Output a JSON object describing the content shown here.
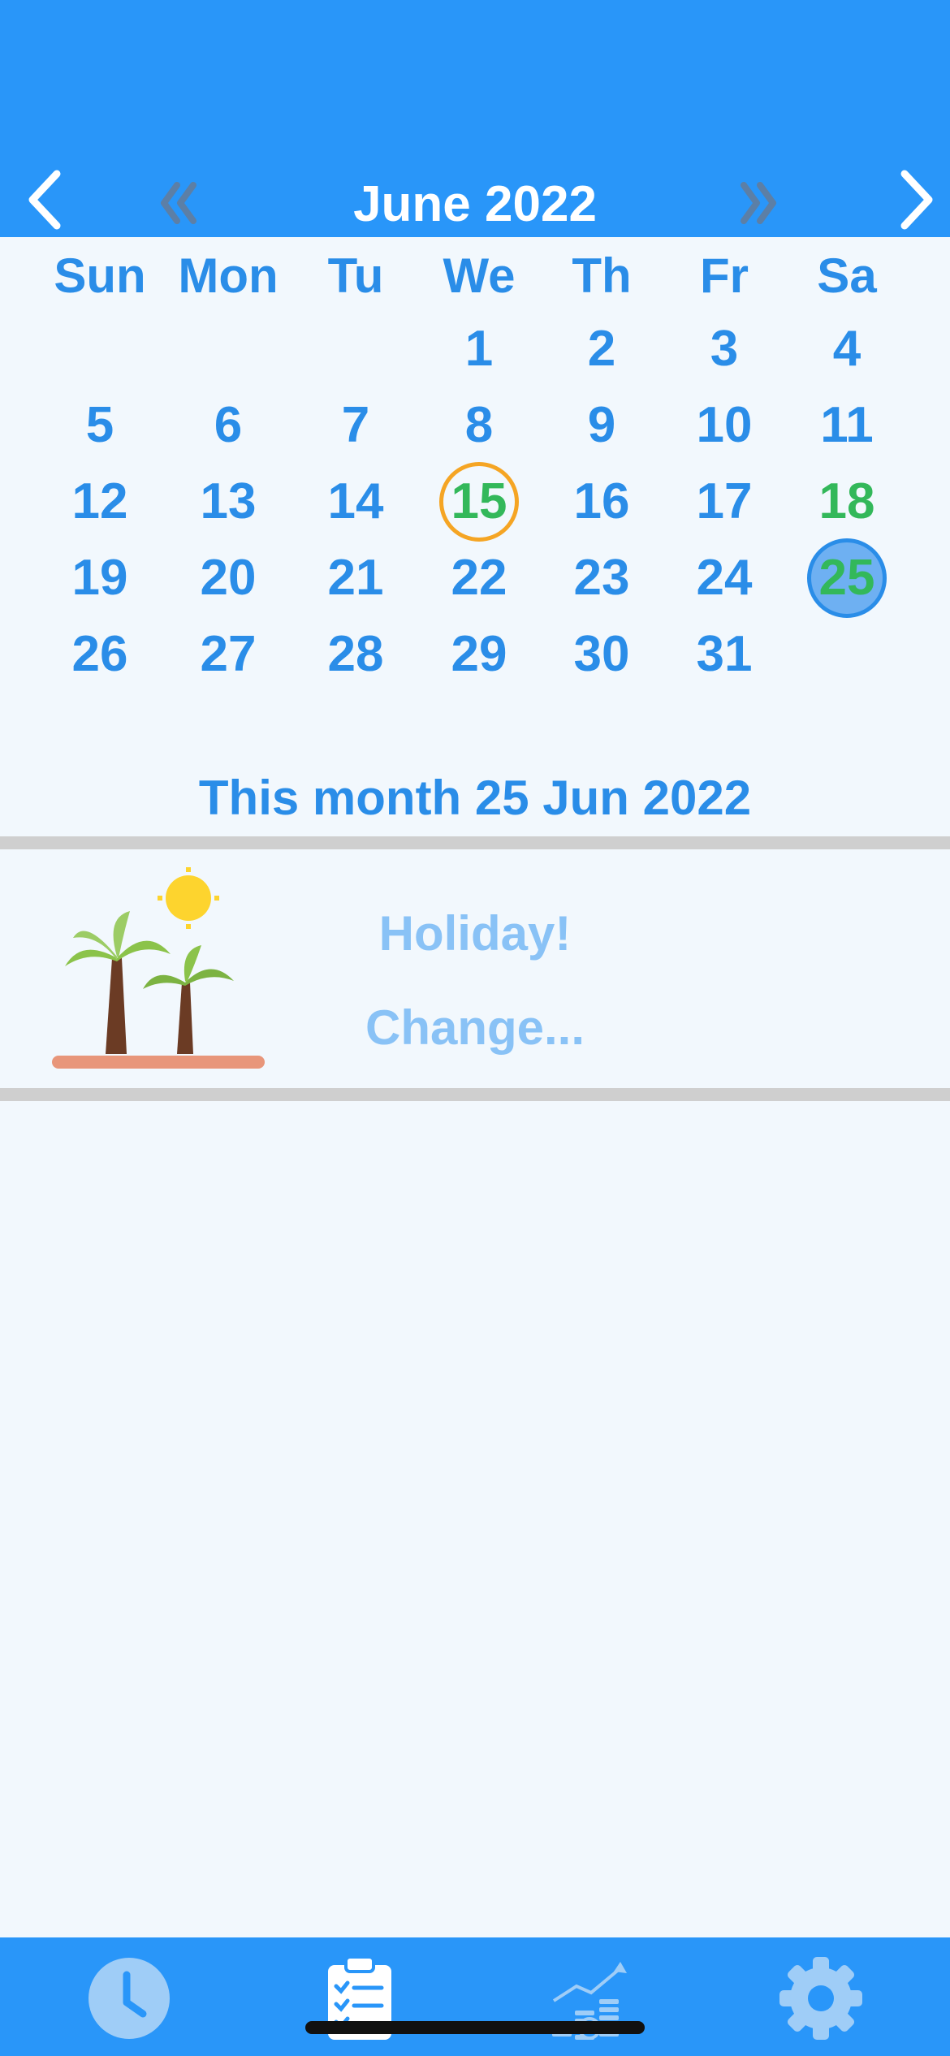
{
  "header": {
    "month_title": "June 2022",
    "icons": {
      "prev_month": "chevron-left-icon",
      "next_month": "chevron-right-icon",
      "prev_year": "double-chevron-left-icon",
      "next_year": "double-chevron-right-icon"
    }
  },
  "calendar": {
    "weekdays": [
      "Sun",
      "Mon",
      "Tu",
      "We",
      "Th",
      "Fr",
      "Sa"
    ],
    "days": [
      "1",
      "2",
      "3",
      "4",
      "5",
      "6",
      "7",
      "8",
      "9",
      "10",
      "11",
      "12",
      "13",
      "14",
      "15",
      "16",
      "17",
      "18",
      "19",
      "20",
      "21",
      "22",
      "23",
      "24",
      "25",
      "26",
      "27",
      "28",
      "29",
      "30",
      "31"
    ],
    "first_weekday_index": 3,
    "today": "15",
    "selected": "25",
    "green_days": [
      "15",
      "18",
      "25"
    ]
  },
  "summary": {
    "text": "This month 25 Jun 2022"
  },
  "event": {
    "title": "Holiday!",
    "change_label": "Change...",
    "icon": "palm-trees-icon"
  },
  "tabbar": {
    "tabs": [
      {
        "name": "clock-icon",
        "active": false
      },
      {
        "name": "clipboard-checklist-icon",
        "active": true
      },
      {
        "name": "chart-coins-icon",
        "active": false
      },
      {
        "name": "gear-icon",
        "active": false
      }
    ]
  },
  "colors": {
    "header_blue": "#2996f9",
    "day_text": "#2a8de8",
    "green_day": "#33b85a",
    "today_ring": "#f5a524",
    "background": "#f2f8fd",
    "event_text": "#89c2f6",
    "divider": "#cfcfcf"
  }
}
